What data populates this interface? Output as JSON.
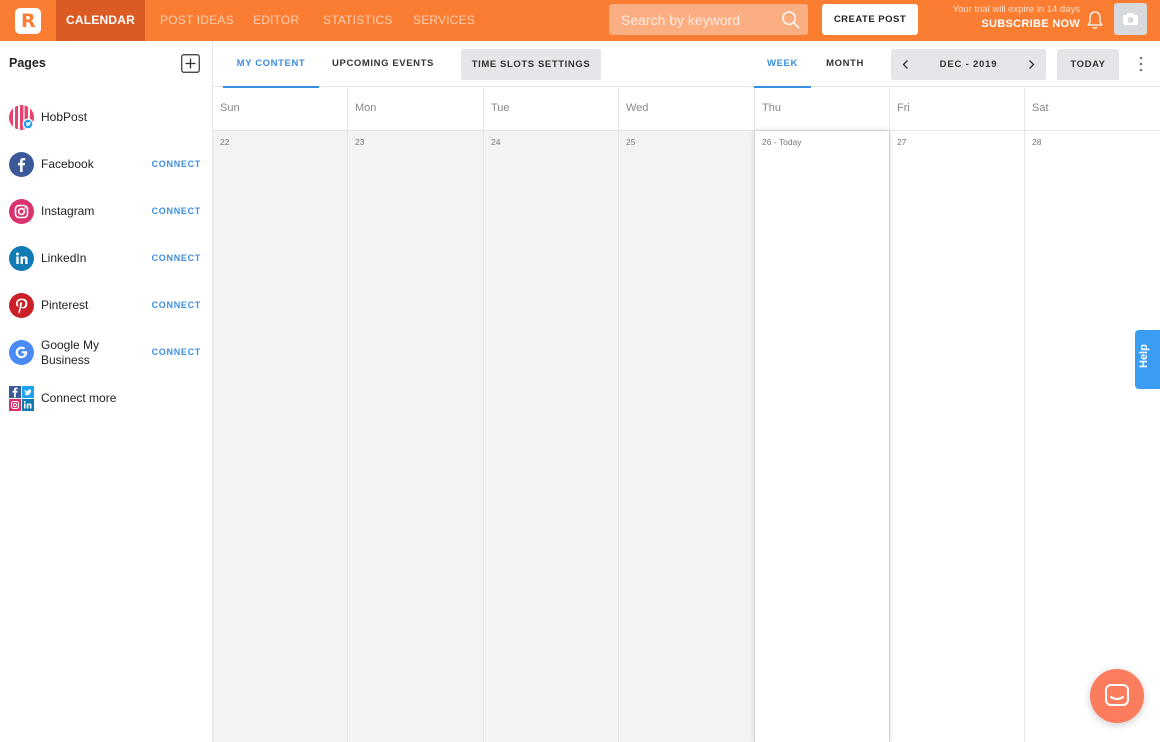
{
  "app": {
    "logo_letter": "R",
    "accent": "#fb7d32",
    "link_color": "#3b8fe3"
  },
  "topnav": {
    "items": [
      {
        "label": "CALENDAR",
        "active": true
      },
      {
        "label": "POST IDEAS"
      },
      {
        "label": "EDITOR"
      },
      {
        "label": "STATISTICS"
      },
      {
        "label": "SERVICES"
      }
    ],
    "search_placeholder": "Search by keyword",
    "create_post": "CREATE POST",
    "trial_line1": "Your trial will expire in 14 days",
    "trial_line2": "SUBSCRIBE NOW"
  },
  "sidebar": {
    "title": "Pages",
    "items": [
      {
        "name": "HobPost",
        "icon": "hobpost-icon",
        "connect": ""
      },
      {
        "name": "Facebook",
        "icon": "facebook-icon",
        "connect": "CONNECT"
      },
      {
        "name": "Instagram",
        "icon": "instagram-icon",
        "connect": "CONNECT"
      },
      {
        "name": "LinkedIn",
        "icon": "linkedin-icon",
        "connect": "CONNECT"
      },
      {
        "name": "Pinterest",
        "icon": "pinterest-icon",
        "connect": "CONNECT"
      },
      {
        "name": "Google My Business",
        "icon": "google-icon",
        "connect": "CONNECT"
      },
      {
        "name": "Connect more",
        "icon": "connect-more-icon",
        "connect": ""
      }
    ]
  },
  "toolbar": {
    "tabs": [
      {
        "label": "MY CONTENT",
        "active": true
      },
      {
        "label": "UPCOMING EVENTS"
      }
    ],
    "time_slots": "TIME SLOTS SETTINGS",
    "views": [
      {
        "label": "WEEK",
        "active": true
      },
      {
        "label": "MONTH"
      }
    ],
    "period": "DEC - 2019",
    "today": "TODAY"
  },
  "calendar": {
    "days": [
      {
        "dow": "Sun",
        "date": "22",
        "state": "past"
      },
      {
        "dow": "Mon",
        "date": "23",
        "state": "past"
      },
      {
        "dow": "Tue",
        "date": "24",
        "state": "past"
      },
      {
        "dow": "Wed",
        "date": "25",
        "state": "past"
      },
      {
        "dow": "Thu",
        "date": "26 - Today",
        "state": "today"
      },
      {
        "dow": "Fri",
        "date": "27",
        "state": "future"
      },
      {
        "dow": "Sat",
        "date": "28",
        "state": "future"
      }
    ]
  },
  "help_label": "Help"
}
